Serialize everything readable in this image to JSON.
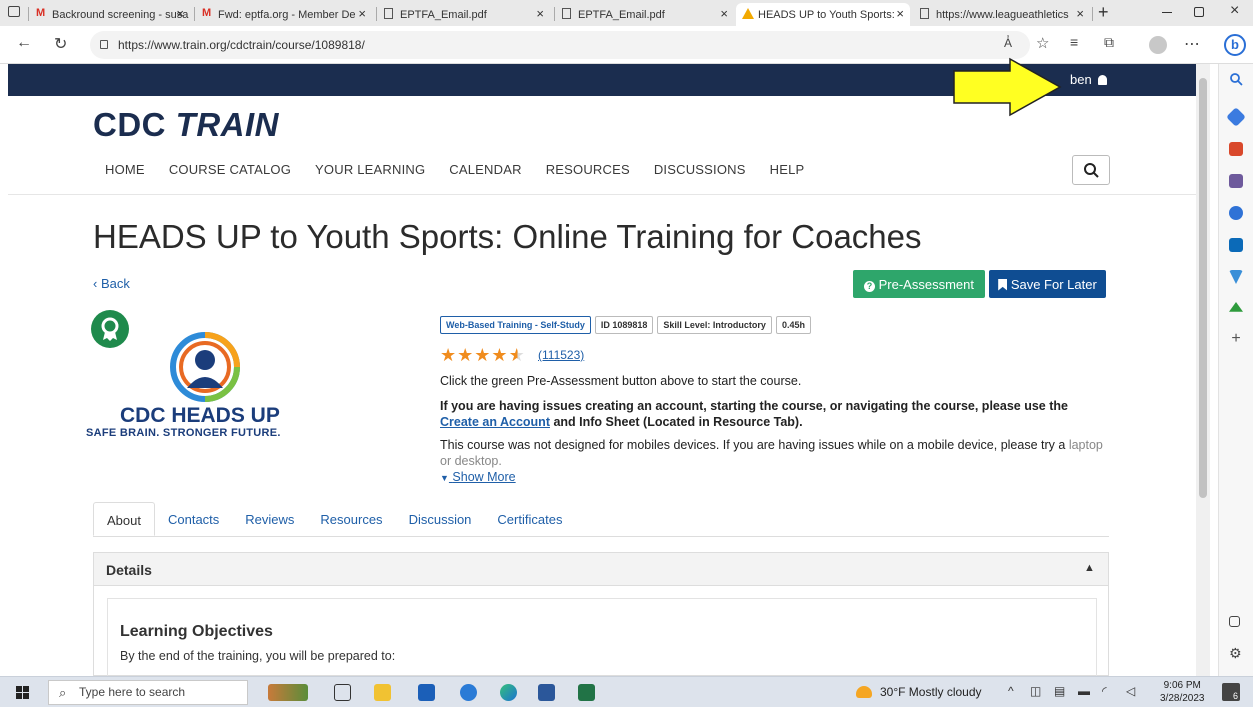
{
  "browser": {
    "tabs": [
      {
        "label": "Backround screening - susa"
      },
      {
        "label": "Fwd: eptfa.org - Member De"
      },
      {
        "label": "EPTFA_Email.pdf"
      },
      {
        "label": "EPTFA_Email.pdf"
      },
      {
        "label": "HEADS UP to Youth Sports:"
      },
      {
        "label": "https://www.leagueathletics"
      }
    ],
    "new_tab": "+",
    "url": "https://www.train.org/cdctrain/course/1089818/",
    "reader_label": "A̓"
  },
  "site": {
    "user": "ben",
    "logo_a": "CDC ",
    "logo_b": "TRAIN",
    "nav": [
      "HOME",
      "COURSE CATALOG",
      "YOUR LEARNING",
      "CALENDAR",
      "RESOURCES",
      "DISCUSSIONS",
      "HELP"
    ]
  },
  "course": {
    "title": "HEADS UP to Youth Sports: Online Training for Coaches",
    "back": "Back",
    "pre_assessment": "Pre-Assessment",
    "save_for_later": "Save For Later",
    "logo_line1": "CDC HEADS UP",
    "logo_line2": "SAFE BRAIN. STRONGER FUTURE.",
    "tags": [
      "Web-Based Training - Self-Study",
      "ID 1089818",
      "Skill Level: Introductory",
      "0.45h"
    ],
    "rating": 4.5,
    "rating_count": "(111523)",
    "desc1": "Click the green Pre-Assessment button above to start the course.",
    "desc2_a": "If you are having issues creating an account, starting the course, or navigating the course, please use the ",
    "desc2_link": "Create an Account",
    "desc2_b": " and Info Sheet (Located in Resource Tab).",
    "desc3": "This course was not designed for mobiles devices. If you are having issues while on a mobile device, please try a",
    "desc3_fade": "laptop or desktop.",
    "show_more": "Show More",
    "tabs": [
      "About",
      "Contacts",
      "Reviews",
      "Resources",
      "Discussion",
      "Certificates"
    ],
    "details_title": "Details",
    "lo_title": "Learning Objectives",
    "lo_text": "By the end of the training, you will be prepared to:"
  },
  "taskbar": {
    "search_placeholder": "Type here to search",
    "weather": "30°F  Mostly cloudy",
    "time": "9:06 PM",
    "date": "3/28/2023",
    "notif_count": "6"
  }
}
